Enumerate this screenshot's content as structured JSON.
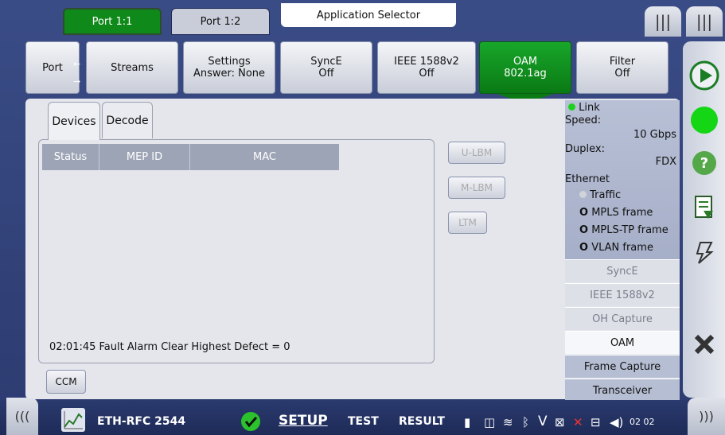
{
  "top": {
    "ports": [
      "Port 1:1",
      "Port 1:2"
    ],
    "app_selector": "Application Selector",
    "menu_glyph": "|||"
  },
  "settings_row": {
    "port": "Port",
    "streams": "Streams",
    "settings_l1": "Settings",
    "settings_l2": "Answer: None",
    "synce_l1": "SyncE",
    "synce_l2": "Off",
    "ieee_l1": "IEEE 1588v2",
    "ieee_l2": "Off",
    "oam_l1": "OAM",
    "oam_l2": "802.1ag",
    "filter_l1": "Filter",
    "filter_l2": "Off"
  },
  "subtabs": [
    "Devices",
    "Decode"
  ],
  "table": {
    "headers": [
      "Status",
      "MEP ID",
      "MAC"
    ]
  },
  "status_line": "02:01:45 Fault Alarm Clear Highest Defect = 0",
  "actions": [
    "U-LBM",
    "M-LBM",
    "LTM"
  ],
  "ccm": "CCM",
  "right_panel": {
    "link": "Link",
    "speed_label": "Speed:",
    "speed_value": "10 Gbps",
    "duplex_label": "Duplex:",
    "duplex_value": "FDX",
    "ethernet": "Ethernet",
    "traffic": "Traffic",
    "mpls": "MPLS frame",
    "mplstp": "MPLS-TP frame",
    "vlan": "VLAN frame",
    "buttons": [
      "SyncE",
      "IEEE 1588v2",
      "OH Capture",
      "OAM",
      "Frame Capture",
      "Transceiver"
    ]
  },
  "bottom": {
    "app_name": "ETH-RFC 2544",
    "setup": "SETUP",
    "test": "TEST",
    "result": "RESULT",
    "time": "02 02",
    "left_glyph": "(((",
    "right_glyph": ")))"
  },
  "colors": {
    "accent_green": "#0a7a14",
    "link_green": "#1fd11f"
  }
}
